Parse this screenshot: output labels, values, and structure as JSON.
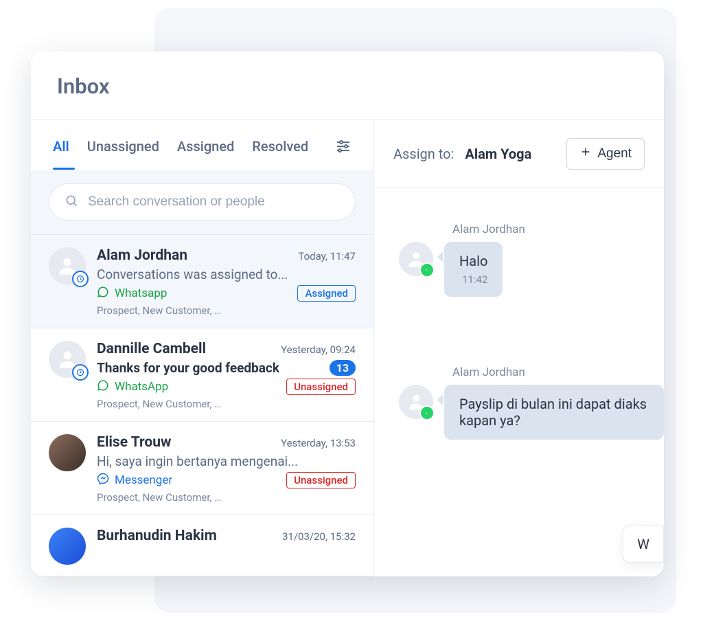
{
  "header": {
    "title": "Inbox"
  },
  "tabs": [
    "All",
    "Unassigned",
    "Assigned",
    "Resolved"
  ],
  "search": {
    "placeholder": "Search conversation or people"
  },
  "conversations": [
    {
      "name": "Alam Jordhan",
      "time": "Today, 11:47",
      "preview": "Conversations was assigned to...",
      "channel": "Whatsapp",
      "status": "Assigned",
      "tags": "Prospect, New Customer, …"
    },
    {
      "name": "Dannille Cambell",
      "time": "Yesterday, 09:24",
      "preview": "Thanks for your good feedback",
      "count": "13",
      "channel": "WhatsApp",
      "status": "Unassigned",
      "tags": "Prospect, New Customer, …"
    },
    {
      "name": "Elise Trouw",
      "time": "Yesterday, 13:53",
      "preview": "Hi, saya ingin bertanya mengenai...",
      "channel": "Messenger",
      "status": "Unassigned",
      "tags": "Prospect, New Customer, …"
    },
    {
      "name": "Burhanudin Hakim",
      "time": "31/03/20, 15:32"
    }
  ],
  "assign": {
    "label": "Assign to:",
    "name": "Alam Yoga",
    "agent_btn": "Agent"
  },
  "messages": [
    {
      "sender": "Alam Jordhan",
      "text": "Halo",
      "time": "11:42"
    },
    {
      "sender": "Alam Jordhan",
      "text": "Payslip di bulan ini dapat diaks kapan ya?"
    }
  ],
  "outgoing_partial": "W"
}
